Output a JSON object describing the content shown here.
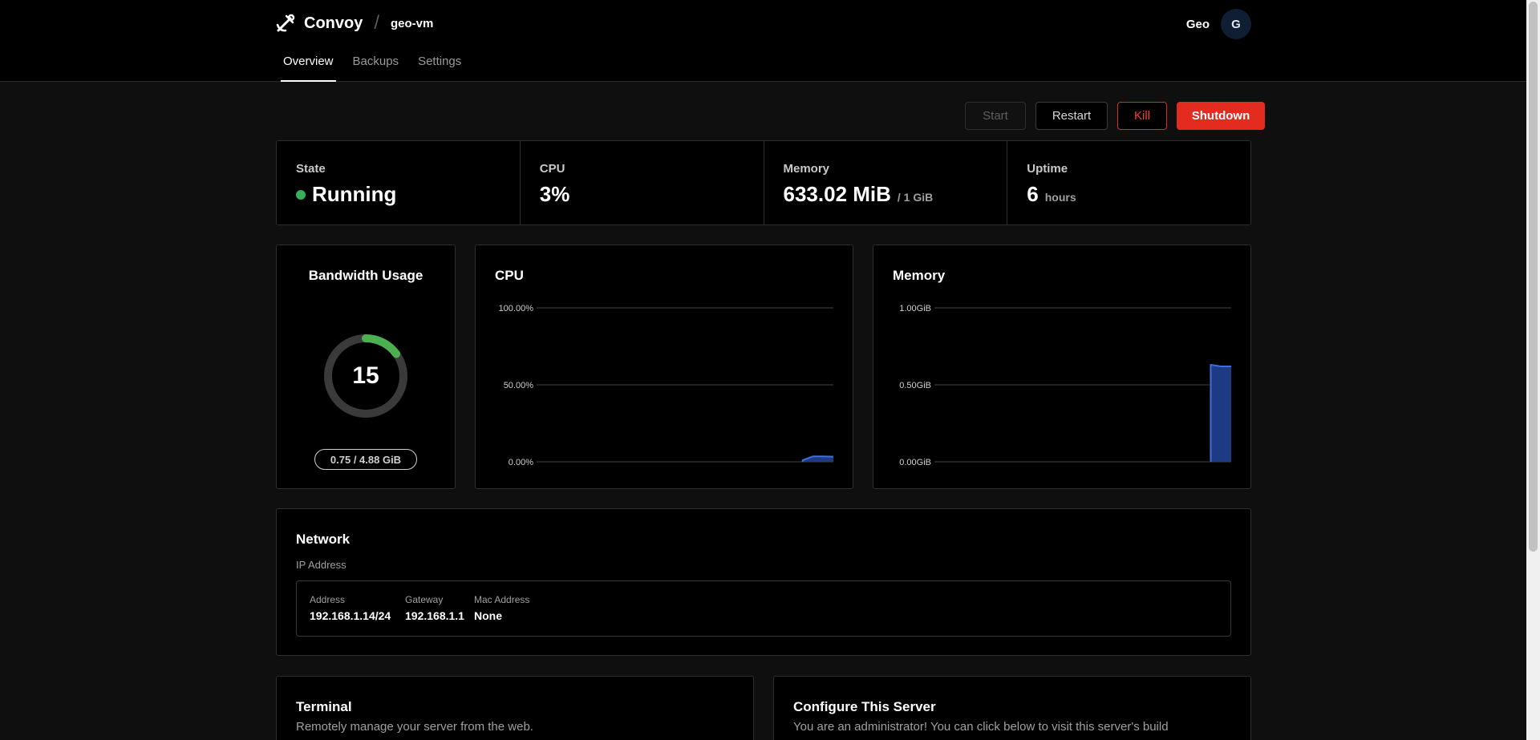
{
  "header": {
    "brand": "Convoy",
    "separator": "/",
    "server_name": "geo-vm",
    "user_name": "Geo",
    "avatar_initial": "G"
  },
  "tabs": [
    {
      "label": "Overview",
      "active": true
    },
    {
      "label": "Backups",
      "active": false
    },
    {
      "label": "Settings",
      "active": false
    }
  ],
  "actions": {
    "start": "Start",
    "restart": "Restart",
    "kill": "Kill",
    "shutdown": "Shutdown"
  },
  "stats": {
    "state": {
      "label": "State",
      "value": "Running",
      "status_color": "#34b05a"
    },
    "cpu": {
      "label": "CPU",
      "value": "3%"
    },
    "memory": {
      "label": "Memory",
      "value": "633.02 MiB",
      "limit": "/ 1 GiB"
    },
    "uptime": {
      "label": "Uptime",
      "value": "6",
      "unit": "hours"
    }
  },
  "bandwidth": {
    "title": "Bandwidth Usage",
    "percent_label": "15",
    "fraction": 0.15,
    "usage": "0.75 / 4.88 GiB",
    "color": "#4caf50"
  },
  "charts": {
    "cpu": {
      "title": "CPU"
    },
    "memory": {
      "title": "Memory"
    }
  },
  "chart_data": [
    {
      "type": "area",
      "title": "CPU",
      "yticks": [
        "100.00%",
        "50.00%",
        "0.00%"
      ],
      "ylim": [
        0,
        100
      ],
      "x": [
        0,
        1,
        2,
        3,
        4,
        5,
        6,
        7,
        8,
        9,
        10,
        11,
        12,
        13,
        14,
        15,
        16,
        17,
        18,
        19,
        20,
        21,
        22,
        23,
        24,
        25,
        26,
        27,
        28,
        29
      ],
      "values": [
        null,
        null,
        null,
        null,
        null,
        null,
        null,
        null,
        null,
        null,
        null,
        null,
        null,
        null,
        null,
        null,
        null,
        null,
        null,
        null,
        null,
        null,
        null,
        null,
        null,
        null,
        1,
        3.5,
        3.5,
        3.3
      ],
      "grid": true,
      "color": "#3d6fe0"
    },
    {
      "type": "area",
      "title": "Memory",
      "yticks": [
        "1.00GiB",
        "0.50GiB",
        "0.00GiB"
      ],
      "ylim": [
        0,
        1
      ],
      "x": [
        0,
        1,
        2,
        3,
        4,
        5,
        6,
        7,
        8,
        9,
        10,
        11,
        12,
        13,
        14,
        15,
        16,
        17,
        18,
        19,
        20,
        21,
        22,
        23,
        24,
        25,
        26,
        27,
        28,
        29
      ],
      "values": [
        null,
        null,
        null,
        null,
        null,
        null,
        null,
        null,
        null,
        null,
        null,
        null,
        null,
        null,
        null,
        null,
        null,
        null,
        null,
        null,
        null,
        null,
        null,
        null,
        null,
        null,
        null,
        0.63,
        0.62,
        0.62
      ],
      "grid": true,
      "color": "#3d6fe0"
    }
  ],
  "network": {
    "title": "Network",
    "subtitle": "IP Address",
    "columns": [
      {
        "label": "Address",
        "value": "192.168.1.14/24"
      },
      {
        "label": "Gateway",
        "value": "192.168.1.1"
      },
      {
        "label": "Mac Address",
        "value": "None"
      }
    ]
  },
  "terminal": {
    "title": "Terminal",
    "description": "Remotely manage your server from the web."
  },
  "configure": {
    "title": "Configure This Server",
    "description": "You are an administrator! You can click below to visit this server's build"
  }
}
